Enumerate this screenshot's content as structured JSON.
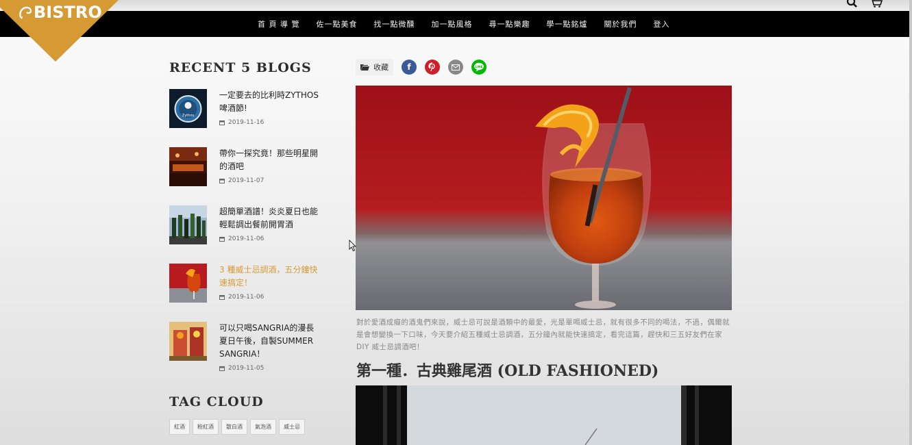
{
  "brand": {
    "name": "BISTRO",
    "color": "#d69a35"
  },
  "top_icons": [
    "search-icon",
    "cart-icon"
  ],
  "nav": {
    "items": [
      "首 頁 導 覽",
      "佐一點美食",
      "找一點微醺",
      "加一點風格",
      "尋一點樂趣",
      "學一點銘爐",
      "關於我們",
      "登入"
    ]
  },
  "sidebar": {
    "recent_heading": "RECENT 5 BLOGS",
    "blogs": [
      {
        "title": "一定要去的比利時ZYTHOS啤酒節!",
        "date": "2019-11-16",
        "thumb": "zythos-logo"
      },
      {
        "title": "帶你一探究竟！那些明星開的酒吧",
        "date": "2019-11-07",
        "thumb": "bar-interior"
      },
      {
        "title": "超簡單酒譜！炎炎夏日也能輕鬆調出餐前開胃酒",
        "date": "2019-11-06",
        "thumb": "bottles"
      },
      {
        "title": "3 種威士忌調酒，五分鐘快速搞定！",
        "date": "2019-11-06",
        "thumb": "orange-cocktail",
        "active": true
      },
      {
        "title": "可以只喝SANGRIA的漫長夏日午後，自製SUMMER SANGRIA！",
        "date": "2019-11-05",
        "thumb": "sangria"
      }
    ],
    "tag_heading": "TAG CLOUD",
    "tags": [
      "紅酒",
      "粉紅酒",
      "散白酒",
      "氣泡酒",
      "威士忌"
    ]
  },
  "share": {
    "collect_label": "收藏",
    "icons": [
      "facebook-icon",
      "pinterest-icon",
      "email-icon",
      "line-icon"
    ],
    "colors": {
      "facebook": "#3b5998",
      "pinterest": "#cb2027",
      "email": "#888888",
      "line": "#00b900"
    }
  },
  "article": {
    "intro": "對於愛酒成癡的酒鬼們來說，威士忌可說是酒類中的最愛，光是單喝威士忌，就有很多不同的喝法，不過，偶爾就是會想變換一下口味，今天要介紹五種威士忌調酒，五分鐘內就能快速搞定，看完這篇，趕快和三五好友們在家 DIY 威士忌調酒吧！",
    "section_title": "第一種．古典雞尾酒 (OLD FASHIONED)"
  }
}
